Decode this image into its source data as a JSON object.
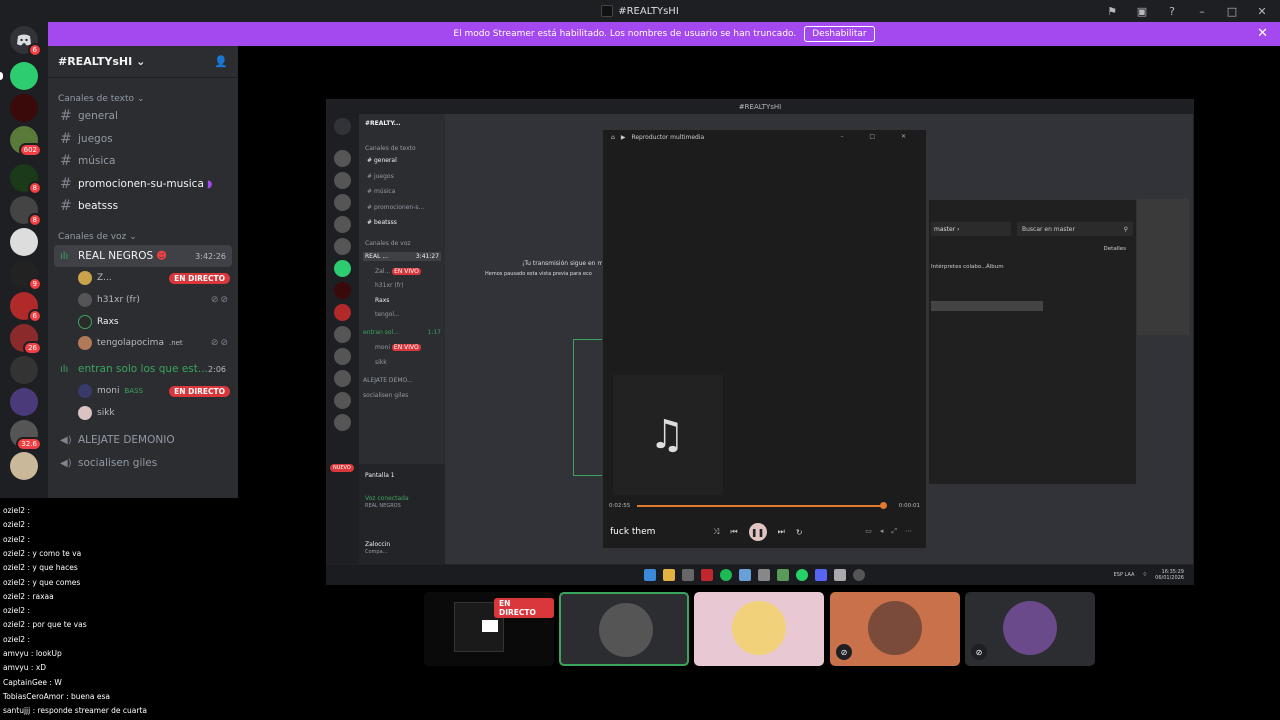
{
  "window": {
    "title": "#REALTYsHI"
  },
  "banner": {
    "text": "El modo Streamer está habilitado. Los nombres de usuario se han truncado.",
    "button": "Deshabilitar"
  },
  "server": {
    "name": "#REALTYsHI"
  },
  "rail_badges": [
    "6",
    "602",
    "8",
    "8",
    "9",
    "6",
    "26",
    "32.6"
  ],
  "sidebar": {
    "text_category": "Canales de texto",
    "text_channels": [
      "general",
      "juegos",
      "música",
      "promocionen-su-musica",
      "beatsss"
    ],
    "voice_category": "Canales de voz",
    "voice_channels": [
      {
        "name": "REAL NEGROS",
        "time": "3:42:26",
        "users": [
          {
            "name": "Z...",
            "live": "EN DIRECTO"
          },
          {
            "name": "h31xr (fr)",
            "live": ""
          },
          {
            "name": "Raxs",
            "live": ""
          },
          {
            "name": "tengolapocima",
            "tag": ".net",
            "live": ""
          }
        ]
      },
      {
        "name": "entran solo los que est...",
        "time": "2:06",
        "users": [
          {
            "name": "moni",
            "tag": "BASS",
            "live": "EN DIRECTO"
          },
          {
            "name": "sikk",
            "live": ""
          }
        ]
      },
      {
        "name": "ALEJATE DEMONIO",
        "time": "",
        "users": []
      },
      {
        "name": "socialisen giles",
        "time": "",
        "users": []
      }
    ]
  },
  "chat": [
    {
      "user": "oziel2",
      "msg": ""
    },
    {
      "user": "oziel2",
      "msg": ""
    },
    {
      "user": "oziel2",
      "msg": ""
    },
    {
      "user": "oziel2",
      "msg": "y como te va"
    },
    {
      "user": "oziel2",
      "msg": "y que haces"
    },
    {
      "user": "oziel2",
      "msg": "y que comes"
    },
    {
      "user": "oziel2",
      "msg": "raxaa"
    },
    {
      "user": "oziel2",
      "msg": ""
    },
    {
      "user": "oziel2",
      "msg": "por que te vas"
    },
    {
      "user": "oziel2",
      "msg": ""
    },
    {
      "user": "amvyu",
      "msg": "lookUp"
    },
    {
      "user": "amvyu",
      "msg": "xD"
    },
    {
      "user": "CaptainGee",
      "msg": "W"
    },
    {
      "user": "TobiasCeroAmor",
      "msg": "buena esa"
    },
    {
      "user": "santujjj",
      "msg": "responde streamer de cuarta"
    }
  ],
  "inner": {
    "title": "#REALTYsHI",
    "server": "#REALTY...",
    "cat_text": "Canales de texto",
    "channels": [
      "general",
      "juegos",
      "música",
      "promocionen-s...",
      "beatsss"
    ],
    "cat_voice": "Canales de voz",
    "voice1": "REAL ...",
    "voice1_time": "3:41:27",
    "voice2": "entran sol...",
    "voice2_time": "1:17",
    "voice3": "ALEJATE DEMO...",
    "voice4": "socialisen giles",
    "users1": [
      "Zal...",
      "h31xr (fr)",
      "Raxs",
      "tengol..."
    ],
    "users2": [
      "moni",
      "sikk"
    ],
    "live": "EN VIVO",
    "new": "NUEVO",
    "screen": "Pantalla 1",
    "voice_conn": "Voz conectada",
    "voice_conn_sub": "REAL NEGROS",
    "user": "Zaloccin",
    "user_status": "Compa...",
    "msg1": "¡Tu transmisión sigue en m",
    "msg2": "Hemos pausado esta vista previa para eco"
  },
  "player": {
    "title": "Reproductor multimedia",
    "elapsed": "0:02:55",
    "remaining": "0:00:01",
    "progress": 0.99,
    "song": "fuck them"
  },
  "explorer": {
    "path": "master",
    "search": "Buscar en master",
    "details": "Detalles",
    "col1": "Intérpretes colabo...",
    "col2": "Álbum"
  },
  "taskbar": {
    "lang": "ESP LAA",
    "time": "16:35:29",
    "date": "06/01/2026"
  },
  "tiles": [
    {
      "live": "EN DIRECTO"
    },
    {},
    {},
    {},
    {}
  ]
}
